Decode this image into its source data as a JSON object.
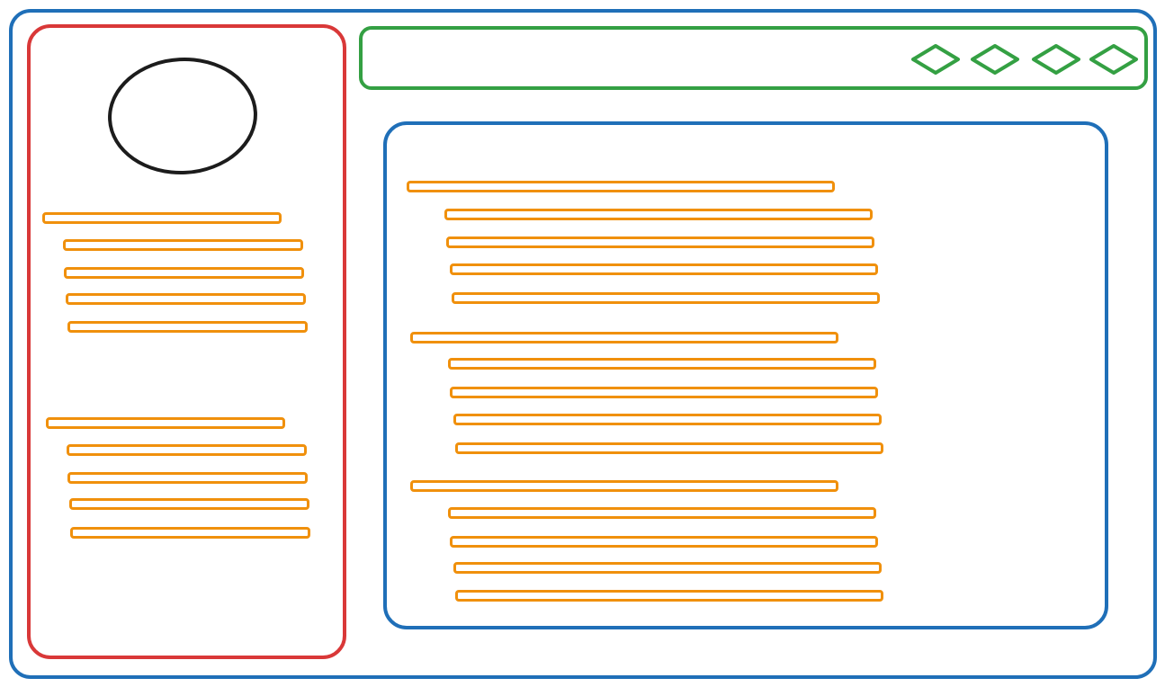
{
  "colors": {
    "outer_frame": "#1f6fb8",
    "sidebar_frame": "#d93838",
    "topbar_frame": "#34a043",
    "main_frame": "#1f6fb8",
    "avatar_outline": "#1c1c1c",
    "text_placeholder": "#f0900c"
  },
  "topbar": {
    "icons": [
      "diamond-icon",
      "diamond-icon",
      "diamond-icon",
      "diamond-icon"
    ]
  },
  "sidebar": {
    "avatar": "avatar-placeholder",
    "sections": [
      {
        "heading": "",
        "items": [
          "",
          "",
          "",
          ""
        ]
      },
      {
        "heading": "",
        "items": [
          "",
          "",
          "",
          ""
        ]
      }
    ]
  },
  "main": {
    "sections": [
      {
        "heading": "",
        "items": [
          "",
          "",
          "",
          ""
        ]
      },
      {
        "heading": "",
        "items": [
          "",
          "",
          "",
          ""
        ]
      },
      {
        "heading": "",
        "items": [
          "",
          "",
          "",
          ""
        ]
      }
    ]
  }
}
